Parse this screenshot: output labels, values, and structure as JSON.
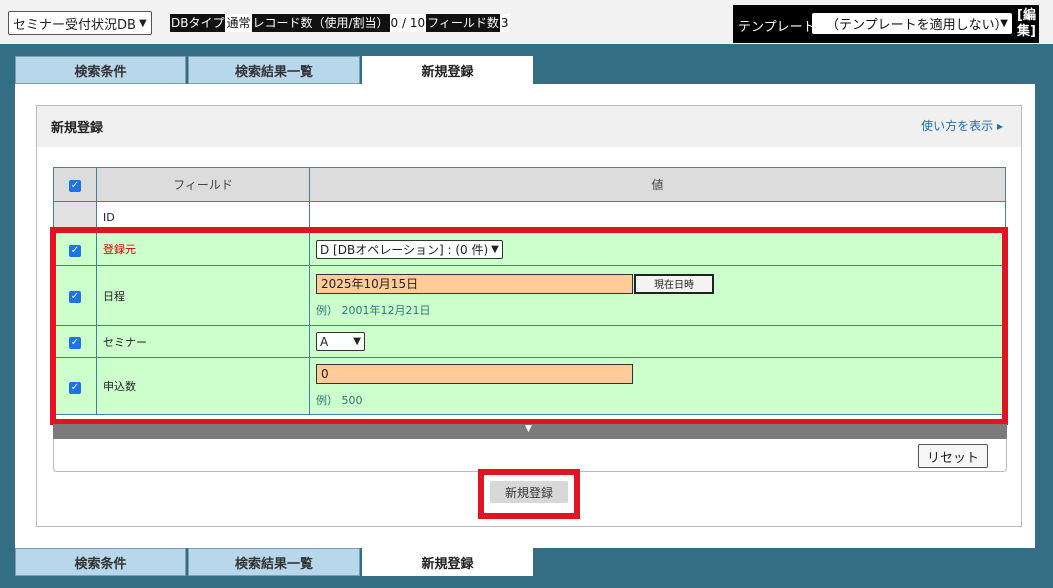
{
  "topbar": {
    "db_select": "セミナー受付状況DB",
    "db_type_label": "DBタイプ",
    "db_type_value": "通常",
    "records_label": "レコード数（使用/割当）",
    "records_value": "0 / 10",
    "fields_label": "フィールド数",
    "fields_value": "3",
    "template_label": "テンプレート",
    "template_value": "（テンプレートを適用しない）",
    "edit_line1": "[編",
    "edit_line2": "集]"
  },
  "tabs": [
    {
      "label": "検索条件"
    },
    {
      "label": "検索結果一覧"
    },
    {
      "label": "新規登録"
    }
  ],
  "form": {
    "title": "新規登録",
    "help_link": "使い方を表示 ▸",
    "header_field": "フィールド",
    "header_value": "値",
    "id_label": "ID",
    "rows": {
      "source": {
        "label": "登録元",
        "value": "D [DBオペレーション] : (0 件)"
      },
      "date": {
        "label": "日程",
        "value": "2025年10月15日",
        "now_button": "現在日時",
        "example": "例） 2001年12月21日"
      },
      "seminar": {
        "label": "セミナー",
        "value": "A"
      },
      "count": {
        "label": "申込数",
        "value": "0",
        "example": "例） 500"
      }
    },
    "reset_button": "リセット",
    "submit_button": "新規登録"
  },
  "colors": {
    "background": "#336e84",
    "row_green": "#ccffcc",
    "input_orange": "#ffcc99",
    "highlight_red": "#e31322",
    "tab_blue": "#b9d7eb"
  }
}
